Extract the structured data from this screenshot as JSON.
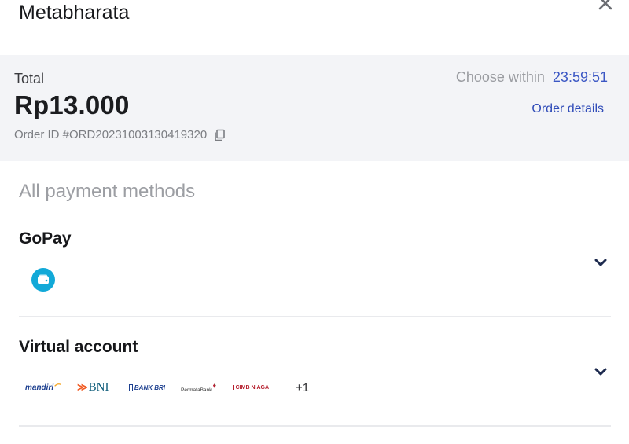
{
  "header": {
    "merchant_name": "Metabharata",
    "close_icon": "close-icon"
  },
  "summary": {
    "total_label": "Total",
    "total_amount": "Rp13.000",
    "order_id": "Order ID #ORD20231003130419320",
    "choose_within_label": "Choose within",
    "timer": "23:59:51",
    "order_details_link": "Order details"
  },
  "methods": {
    "title": "All payment methods",
    "gopay": {
      "title": "GoPay",
      "icon": "wallet-icon"
    },
    "virtual_account": {
      "title": "Virtual account",
      "banks": {
        "mandiri": "mandiri",
        "bni": "BNI",
        "bri": "BANK BRI",
        "permata": "PermataBank",
        "cimb": "CIMB NIAGA"
      },
      "more": "+1"
    }
  },
  "colors": {
    "accent_blue": "#2f4bb8",
    "summary_bg": "#f3f4f7",
    "gopay_blue": "#12a9d8"
  }
}
